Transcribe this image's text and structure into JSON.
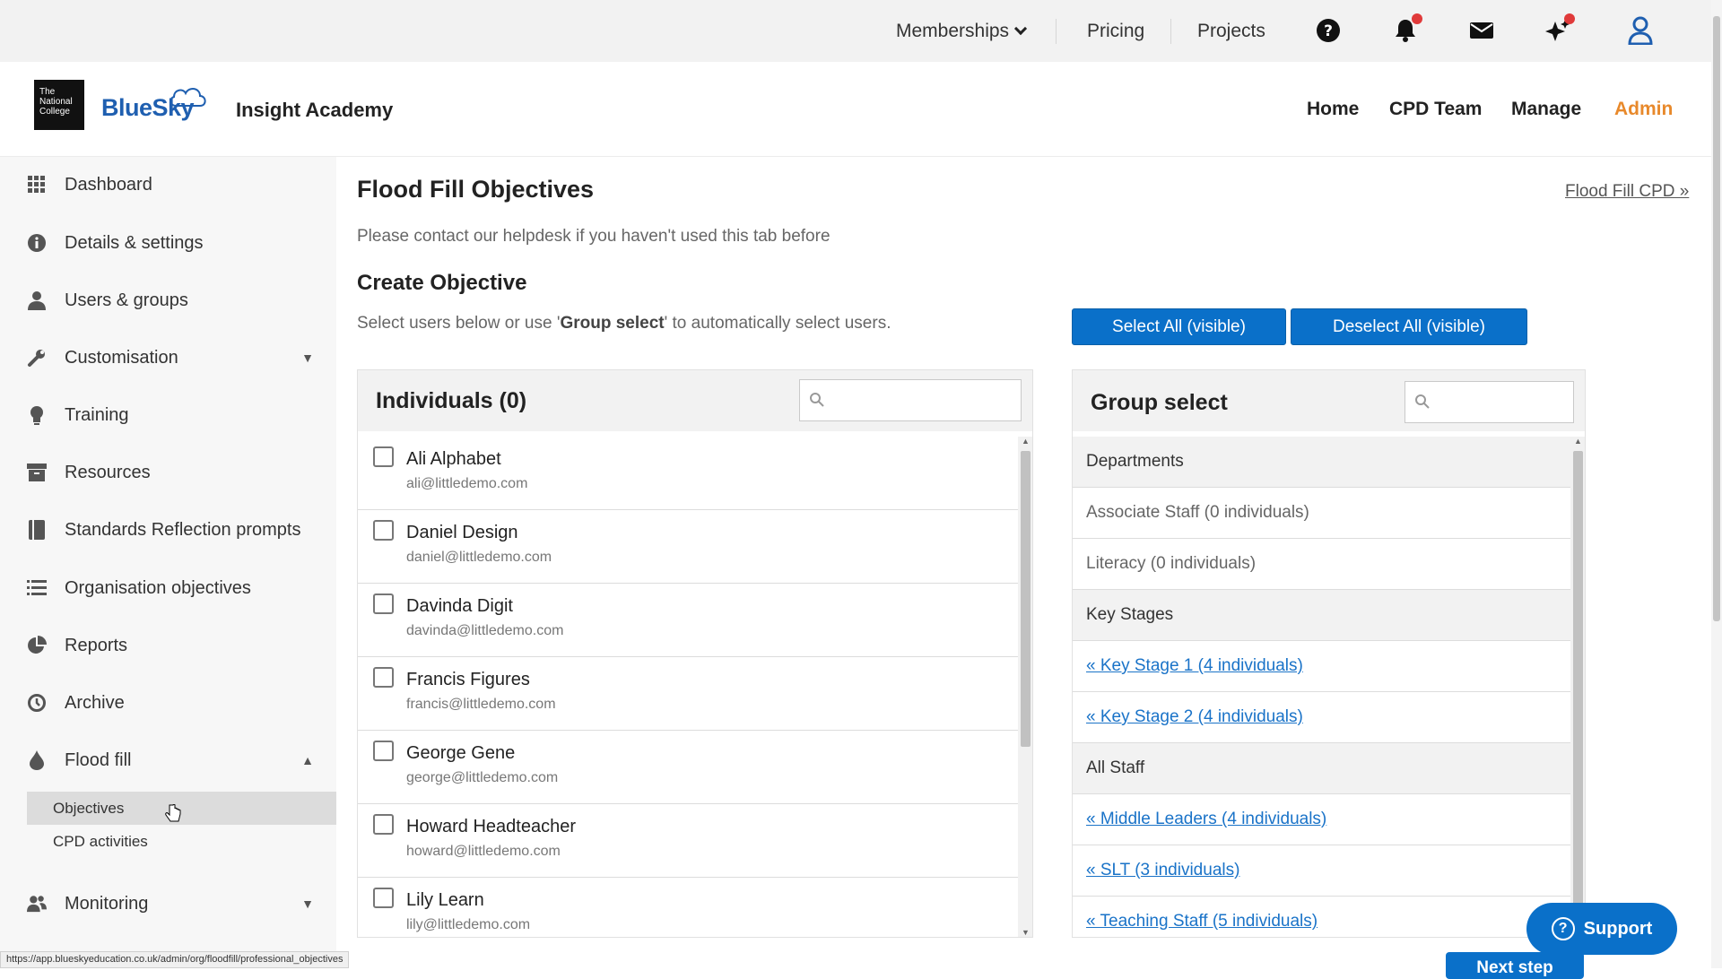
{
  "topbar": {
    "memberships": "Memberships",
    "pricing": "Pricing",
    "projects": "Projects",
    "icons": [
      "help-icon",
      "bell-icon",
      "mail-icon",
      "sparkle-icon",
      "user-icon"
    ]
  },
  "header": {
    "college_logo_text": "The National College",
    "brand": "BlueSky",
    "academy": "Insight Academy",
    "nav": [
      "Home",
      "CPD Team",
      "Manage",
      "Admin"
    ],
    "accent_color": "#e8892b"
  },
  "sidebar": {
    "items": [
      {
        "label": "Dashboard",
        "icon": "grid-icon"
      },
      {
        "label": "Details & settings",
        "icon": "info-icon"
      },
      {
        "label": "Users & groups",
        "icon": "user-icon"
      },
      {
        "label": "Customisation",
        "icon": "wrench-icon"
      },
      {
        "label": "Training",
        "icon": "lightbulb-icon"
      },
      {
        "label": "Resources",
        "icon": "archive-box-icon"
      },
      {
        "label": "Standards Reflection prompts",
        "icon": "book-icon"
      },
      {
        "label": "Organisation objectives",
        "icon": "list-icon"
      },
      {
        "label": "Reports",
        "icon": "pie-chart-icon"
      },
      {
        "label": "Archive",
        "icon": "history-icon"
      },
      {
        "label": "Flood fill",
        "icon": "drop-icon"
      },
      {
        "label": "Monitoring",
        "icon": "users-icon"
      }
    ],
    "flood_fill_sub": [
      "Objectives",
      "CPD activities"
    ]
  },
  "main": {
    "title": "Flood Fill Objectives",
    "cpd_link": "Flood Fill CPD »",
    "helpdesk_note": "Please contact our helpdesk if you haven't used this tab before",
    "create_title": "Create Objective",
    "select_note_prefix": "Select users below or use '",
    "select_note_bold": "Group select",
    "select_note_suffix": "' to automatically select users.",
    "select_all": "Select All (visible)",
    "deselect_all": "Deselect All (visible)"
  },
  "individuals": {
    "title": "Individuals (0)",
    "people": [
      {
        "name": "Ali Alphabet",
        "email": "ali@littledemo.com"
      },
      {
        "name": "Daniel Design",
        "email": "daniel@littledemo.com"
      },
      {
        "name": "Davinda Digit",
        "email": "davinda@littledemo.com"
      },
      {
        "name": "Francis Figures",
        "email": "francis@littledemo.com"
      },
      {
        "name": "George Gene",
        "email": "george@littledemo.com"
      },
      {
        "name": "Howard Headteacher",
        "email": "howard@littledemo.com"
      },
      {
        "name": "Lily Learn",
        "email": "lily@littledemo.com"
      }
    ]
  },
  "groups": {
    "title": "Group select",
    "rows": [
      {
        "type": "hd",
        "label": "Departments"
      },
      {
        "type": "plain",
        "label": "Associate Staff (0 individuals)"
      },
      {
        "type": "plain",
        "label": "Literacy (0 individuals)"
      },
      {
        "type": "hd",
        "label": "Key Stages"
      },
      {
        "type": "link",
        "label": "« Key Stage 1 (4 individuals)"
      },
      {
        "type": "link",
        "label": "« Key Stage 2 (4 individuals)"
      },
      {
        "type": "hd",
        "label": "All Staff"
      },
      {
        "type": "link",
        "label": "« Middle Leaders (4 individuals)"
      },
      {
        "type": "link",
        "label": "« SLT (3 individuals)"
      },
      {
        "type": "link",
        "label": "« Teaching Staff (5 individuals)"
      }
    ]
  },
  "support": "Support",
  "next_step": "Next step",
  "status_url": "https://app.blueskyeducation.co.uk/admin/org/floodfill/professional_objectives"
}
